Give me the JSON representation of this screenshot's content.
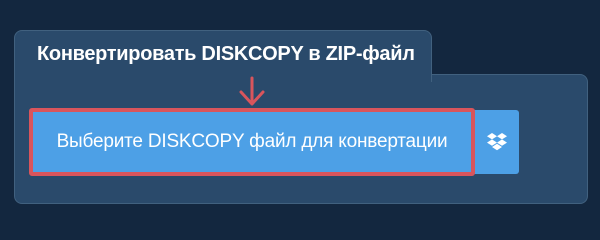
{
  "panel": {
    "title": "Конвертировать DISKCOPY в ZIP-файл"
  },
  "upload": {
    "select_label": "Выберите DISKCOPY файл для конвертации",
    "dropbox_icon": "dropbox-icon",
    "arrow_icon": "arrow-down-icon"
  },
  "colors": {
    "background": "#13273f",
    "panel": "#2a4a6b",
    "button": "#4da0e6",
    "highlight": "#d9555c"
  }
}
